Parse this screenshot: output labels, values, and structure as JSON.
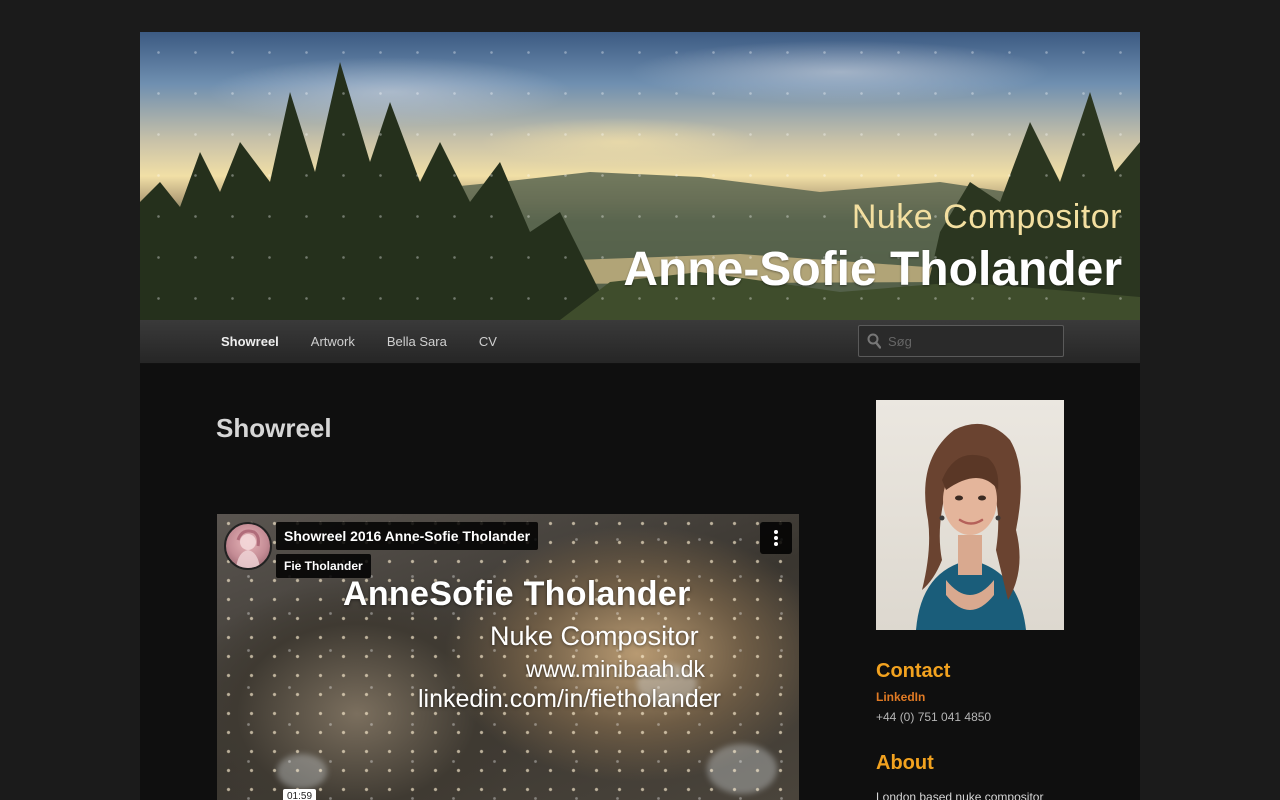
{
  "banner": {
    "subtitle": "Nuke Compositor",
    "title": "Anne-Sofie Tholander"
  },
  "nav": {
    "items": [
      {
        "label": "Showreel",
        "active": true
      },
      {
        "label": "Artwork",
        "active": false
      },
      {
        "label": "Bella Sara",
        "active": false
      },
      {
        "label": "CV",
        "active": false
      }
    ],
    "search_placeholder": "Søg"
  },
  "entry": {
    "title": "Showreel"
  },
  "video": {
    "title": "Showreel 2016 Anne-Sofie Tholander",
    "channel": "Fie Tholander",
    "overlay_lines": [
      "AnneSofie Tholander",
      "Nuke Compositor",
      "www.minibaah.dk",
      "linkedin.com/in/fietholander"
    ],
    "duration": "01:59"
  },
  "sidebar": {
    "contact_heading": "Contact",
    "linkedin_label": "LinkedIn",
    "phone": "+44 (0) 751 041 4850",
    "about_heading": "About",
    "about_text": "London based nuke compositor"
  },
  "colors": {
    "accent_heading": "#f2a21f",
    "link": "#e07a24",
    "background": "#1b1b1b",
    "content_background": "#0f0f0f"
  }
}
